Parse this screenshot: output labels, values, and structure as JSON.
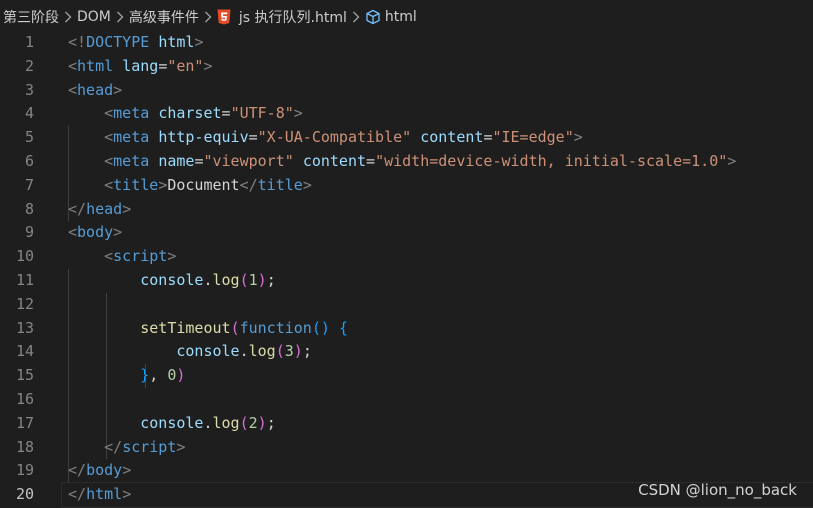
{
  "breadcrumb": {
    "items": [
      "第三阶段",
      "DOM",
      "高级事件件",
      "js 执行队列.html",
      "html"
    ]
  },
  "line_numbers": [
    "1",
    "2",
    "3",
    "4",
    "5",
    "6",
    "7",
    "8",
    "9",
    "10",
    "11",
    "12",
    "13",
    "14",
    "15",
    "16",
    "17",
    "18",
    "19",
    "20"
  ],
  "active_line": 20,
  "code_lines": [
    [
      [
        "t-punc",
        "<!"
      ],
      [
        "t-doctype",
        "DOCTYPE"
      ],
      [
        "t-text",
        " "
      ],
      [
        "t-attr",
        "html"
      ],
      [
        "t-punc",
        ">"
      ]
    ],
    [
      [
        "t-punc",
        "<"
      ],
      [
        "t-tag",
        "html"
      ],
      [
        "t-text",
        " "
      ],
      [
        "t-attr",
        "lang"
      ],
      [
        "t-text",
        "="
      ],
      [
        "t-str",
        "\"en\""
      ],
      [
        "t-punc",
        ">"
      ]
    ],
    [
      [
        "t-punc",
        "<"
      ],
      [
        "t-tag",
        "head"
      ],
      [
        "t-punc",
        ">"
      ]
    ],
    [
      [
        "t-text",
        "    "
      ],
      [
        "t-punc",
        "<"
      ],
      [
        "t-tag",
        "meta"
      ],
      [
        "t-text",
        " "
      ],
      [
        "t-attr",
        "charset"
      ],
      [
        "t-text",
        "="
      ],
      [
        "t-str",
        "\"UTF-8\""
      ],
      [
        "t-punc",
        ">"
      ]
    ],
    [
      [
        "t-text",
        "    "
      ],
      [
        "t-punc",
        "<"
      ],
      [
        "t-tag",
        "meta"
      ],
      [
        "t-text",
        " "
      ],
      [
        "t-attr",
        "http-equiv"
      ],
      [
        "t-text",
        "="
      ],
      [
        "t-str",
        "\"X-UA-Compatible\""
      ],
      [
        "t-text",
        " "
      ],
      [
        "t-attr",
        "content"
      ],
      [
        "t-text",
        "="
      ],
      [
        "t-str",
        "\"IE=edge\""
      ],
      [
        "t-punc",
        ">"
      ]
    ],
    [
      [
        "t-text",
        "    "
      ],
      [
        "t-punc",
        "<"
      ],
      [
        "t-tag",
        "meta"
      ],
      [
        "t-text",
        " "
      ],
      [
        "t-attr",
        "name"
      ],
      [
        "t-text",
        "="
      ],
      [
        "t-str",
        "\"viewport\""
      ],
      [
        "t-text",
        " "
      ],
      [
        "t-attr",
        "content"
      ],
      [
        "t-text",
        "="
      ],
      [
        "t-str",
        "\"width=device-width, initial-scale=1.0\""
      ],
      [
        "t-punc",
        ">"
      ]
    ],
    [
      [
        "t-text",
        "    "
      ],
      [
        "t-punc",
        "<"
      ],
      [
        "t-tag",
        "title"
      ],
      [
        "t-punc",
        ">"
      ],
      [
        "t-text",
        "Document"
      ],
      [
        "t-punc",
        "</"
      ],
      [
        "t-tag",
        "title"
      ],
      [
        "t-punc",
        ">"
      ]
    ],
    [
      [
        "t-punc",
        "</"
      ],
      [
        "t-tag",
        "head"
      ],
      [
        "t-punc",
        ">"
      ]
    ],
    [
      [
        "t-punc",
        "<"
      ],
      [
        "t-tag",
        "body"
      ],
      [
        "t-punc",
        ">"
      ]
    ],
    [
      [
        "t-text",
        "    "
      ],
      [
        "t-punc",
        "<"
      ],
      [
        "t-tag",
        "script"
      ],
      [
        "t-punc",
        ">"
      ]
    ],
    [
      [
        "t-text",
        "        "
      ],
      [
        "t-var",
        "console"
      ],
      [
        "t-text",
        "."
      ],
      [
        "t-fn",
        "log"
      ],
      [
        "t-b1",
        "("
      ],
      [
        "t-num",
        "1"
      ],
      [
        "t-b1",
        ")"
      ],
      [
        "t-text",
        ";"
      ]
    ],
    [],
    [
      [
        "t-text",
        "        "
      ],
      [
        "t-fn",
        "setTimeout"
      ],
      [
        "t-b1",
        "("
      ],
      [
        "t-kw",
        "function"
      ],
      [
        "t-b2",
        "()"
      ],
      [
        "t-text",
        " "
      ],
      [
        "t-b2",
        "{"
      ]
    ],
    [
      [
        "t-text",
        "            "
      ],
      [
        "t-var",
        "console"
      ],
      [
        "t-text",
        "."
      ],
      [
        "t-fn",
        "log"
      ],
      [
        "t-b1",
        "("
      ],
      [
        "t-num",
        "3"
      ],
      [
        "t-b1",
        ")"
      ],
      [
        "t-text",
        ";"
      ]
    ],
    [
      [
        "t-text",
        "        "
      ],
      [
        "t-b2",
        "}"
      ],
      [
        "t-text",
        ", "
      ],
      [
        "t-num",
        "0"
      ],
      [
        "t-b1",
        ")"
      ]
    ],
    [],
    [
      [
        "t-text",
        "        "
      ],
      [
        "t-var",
        "console"
      ],
      [
        "t-text",
        "."
      ],
      [
        "t-fn",
        "log"
      ],
      [
        "t-b1",
        "("
      ],
      [
        "t-num",
        "2"
      ],
      [
        "t-b1",
        ")"
      ],
      [
        "t-text",
        ";"
      ]
    ],
    [
      [
        "t-text",
        "    "
      ],
      [
        "t-punc",
        "</"
      ],
      [
        "t-tag",
        "script"
      ],
      [
        "t-punc",
        ">"
      ]
    ],
    [
      [
        "t-punc",
        "</"
      ],
      [
        "t-tag",
        "body"
      ],
      [
        "t-punc",
        ">"
      ]
    ],
    [
      [
        "t-punc",
        "</"
      ],
      [
        "t-tag",
        "html"
      ],
      [
        "t-punc",
        ">"
      ]
    ]
  ],
  "watermark": "CSDN @lion_no_back",
  "colors": {
    "background": "#1e1e1e",
    "tag": "#569cd6",
    "attribute": "#9cdcfe",
    "string": "#ce9178",
    "function": "#dcdcaa",
    "number": "#b5cea8",
    "bracket_level1": "#da70d6",
    "bracket_level2": "#179fff",
    "html5_icon": "#e34c26"
  },
  "icons": {
    "chevron": "chevron-right-icon",
    "file": "html5-icon",
    "symbol": "tag-icon"
  }
}
